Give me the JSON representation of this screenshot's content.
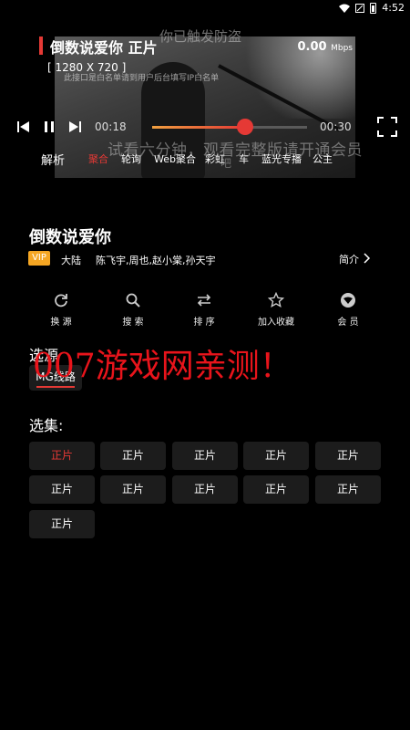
{
  "status_bar": {
    "time": "4:52"
  },
  "player": {
    "title": "倒数说爱你 正片",
    "speed_value": "0.00",
    "speed_unit": "Mbps",
    "resolution": "[ 1280 X 720 ]",
    "notice": "此接口是白名单请到用户后台填写IP白名单",
    "watermark_top": "你已触发防盗",
    "elapsed": "00:18",
    "duration": "00:30",
    "progress": 0.6,
    "promo_overlay": "试看六分钟，观看完整版请开通会员",
    "promo_tail": "吧"
  },
  "tabs": {
    "label": "解析",
    "items": [
      "聚合",
      "轮询",
      "Web聚合",
      "彩虹",
      "车",
      "蓝光专播",
      "公主"
    ],
    "active_index": 0,
    "accent": "#e53935"
  },
  "show": {
    "title": "倒数说爱你",
    "vip": "VIP",
    "region": "大陆",
    "cast": "陈飞宇,周也,赵小棠,孙天宇",
    "intro": "简介"
  },
  "actions": [
    {
      "label": "换 源",
      "icon": "refresh-icon"
    },
    {
      "label": "搜 索",
      "icon": "search-icon"
    },
    {
      "label": "排 序",
      "icon": "sort-icon"
    },
    {
      "label": "加入收藏",
      "icon": "star-icon"
    },
    {
      "label": "会 员",
      "icon": "member-icon"
    }
  ],
  "source": {
    "title": "选源",
    "line": "MG线路",
    "overlay": "007游戏网亲测！"
  },
  "episodes": {
    "title": "选集:",
    "items": [
      "正片",
      "正片",
      "正片",
      "正片",
      "正片",
      "正片",
      "正片",
      "正片",
      "正片",
      "正片",
      "正片"
    ],
    "active_index": 0
  }
}
